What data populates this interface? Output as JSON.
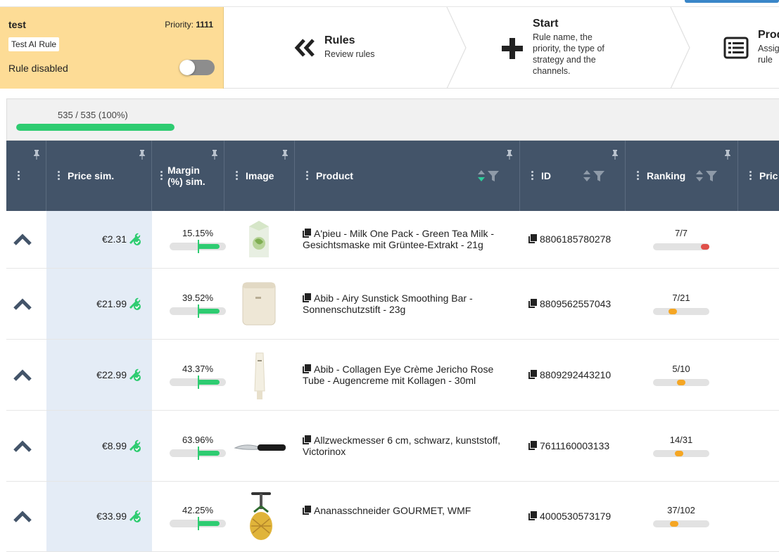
{
  "rule": {
    "name": "test",
    "priority_label": "Priority:",
    "priority_value": "1111",
    "tag": "Test AI Rule",
    "status": "Rule disabled",
    "enabled": false
  },
  "steps": [
    {
      "title": "Rules",
      "subtitle": "Review rules",
      "icon": "double-chevron-left-icon"
    },
    {
      "title": "Start",
      "subtitle": "Rule name, the priority, the type of strategy and the channels.",
      "icon": "plus-icon"
    },
    {
      "title": "Prod",
      "subtitle": "Assig rule",
      "icon": "list-icon"
    }
  ],
  "progress": {
    "text": "535 / 535 (100%)",
    "fraction": 1.0
  },
  "columns": [
    {
      "key": "expand",
      "label": ""
    },
    {
      "key": "price",
      "label": "Price sim."
    },
    {
      "key": "margin",
      "label": "Margin (%) sim."
    },
    {
      "key": "image",
      "label": "Image"
    },
    {
      "key": "product",
      "label": "Product"
    },
    {
      "key": "id",
      "label": "ID"
    },
    {
      "key": "ranking",
      "label": "Ranking"
    },
    {
      "key": "price2",
      "label": "Pric"
    }
  ],
  "rows": [
    {
      "price": "€2.31",
      "margin": "15.15%",
      "margin_fraction": 0.15,
      "product": "A'pieu - Milk One Pack - Green Tea Milk - Gesichtsmaske mit Grüntee-Extrakt - 21g",
      "id": "8806185780278",
      "ranking": "7/7",
      "rank_fraction": 1.0,
      "rank_color": "#e0504a"
    },
    {
      "price": "€21.99",
      "margin": "39.52%",
      "margin_fraction": 0.4,
      "product": "Abib - Airy Sunstick Smoothing Bar - Sonnenschutzstift - 23g",
      "id": "8809562557043",
      "ranking": "7/21",
      "rank_fraction": 0.33,
      "rank_color": "#f5a623"
    },
    {
      "price": "€22.99",
      "margin": "43.37%",
      "margin_fraction": 0.43,
      "product": "Abib - Collagen Eye Crème Jericho Rose Tube - Augencreme mit Kollagen - 30ml",
      "id": "8809292443210",
      "ranking": "5/10",
      "rank_fraction": 0.5,
      "rank_color": "#f5a623"
    },
    {
      "price": "€8.99",
      "margin": "63.96%",
      "margin_fraction": 0.64,
      "product": "Allzweckmesser 6 cm, schwarz, kunststoff, Victorinox",
      "id": "7611160003133",
      "ranking": "14/31",
      "rank_fraction": 0.45,
      "rank_color": "#f5a623"
    },
    {
      "price": "€33.99",
      "margin": "42.25%",
      "margin_fraction": 0.42,
      "product": "Ananasschneider GOURMET, WMF",
      "id": "4000530573179",
      "ranking": "37/102",
      "rank_fraction": 0.36,
      "rank_color": "#f5a623"
    }
  ]
}
